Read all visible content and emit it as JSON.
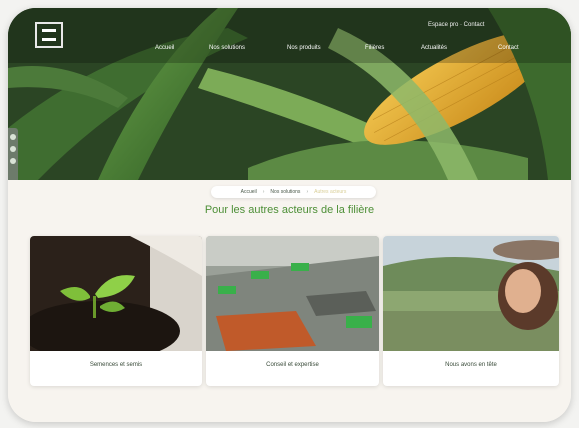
{
  "header": {
    "logo_icon": "logo-icon",
    "top_link": "Espace pro · Contact",
    "nav": [
      "Accueil",
      "Nos solutions",
      "Nos produits",
      "Filières",
      "Actualités",
      "Contact"
    ]
  },
  "breadcrumb": [
    "Accueil",
    "Nos solutions",
    "Autres acteurs"
  ],
  "page": {
    "title": "Pour les autres acteurs de la filière"
  },
  "cards": [
    {
      "label": "Semences et semis"
    },
    {
      "label": "Conseil et expertise"
    },
    {
      "label": "Nous avons en tête"
    }
  ]
}
